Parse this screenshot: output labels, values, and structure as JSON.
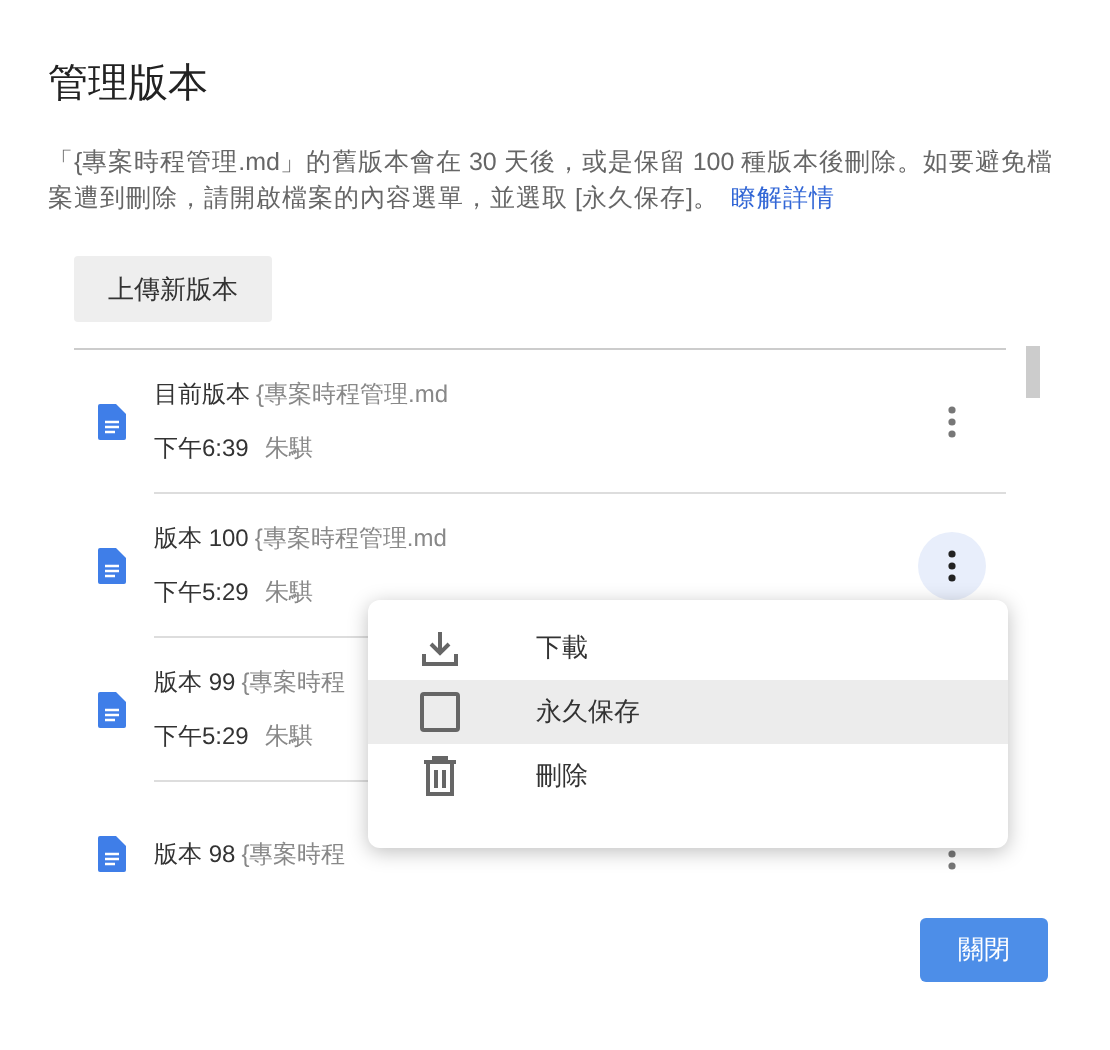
{
  "dialog": {
    "title": "管理版本",
    "description": "「{專案時程管理.md」的舊版本會在 30 天後，或是保留 100 種版本後刪除。如要避免檔案遭到刪除，請開啟檔案的內容選單，並選取 [永久保存]。",
    "learn_more": "瞭解詳情",
    "upload_button": "上傳新版本",
    "close_button": "關閉"
  },
  "versions": [
    {
      "label": "目前版本",
      "file": "{專案時程管理.md",
      "time": "下午6:39",
      "author": "朱騏",
      "menu_open": false
    },
    {
      "label": "版本 100",
      "file": "{專案時程管理.md",
      "time": "下午5:29",
      "author": "朱騏",
      "menu_open": true
    },
    {
      "label": "版本 99",
      "file": "{專案時程",
      "time": "下午5:29",
      "author": "朱騏"
    },
    {
      "label": "版本 98",
      "file": "{專案時程",
      "menu_open": false
    }
  ],
  "menu": [
    {
      "kind": "download",
      "label": "下載",
      "highlighted": false
    },
    {
      "kind": "checkbox",
      "label": "永久保存",
      "checked": false,
      "highlighted": true
    },
    {
      "kind": "delete",
      "label": "刪除",
      "highlighted": false
    }
  ]
}
